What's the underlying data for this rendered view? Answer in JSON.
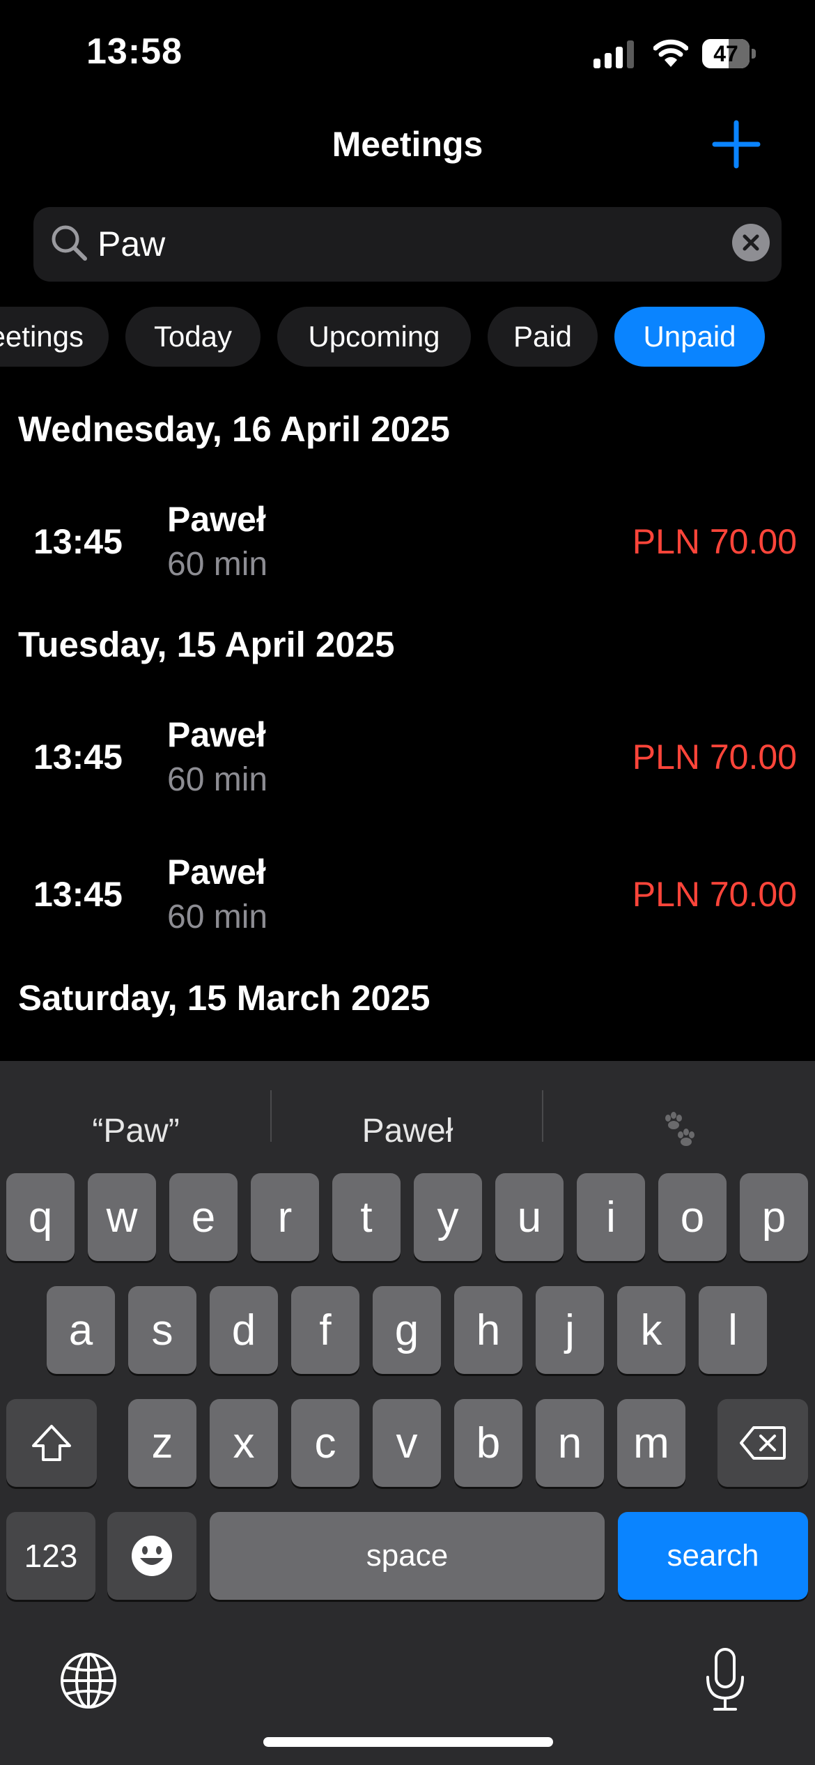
{
  "status_bar": {
    "time": "13:58",
    "battery": "47"
  },
  "nav": {
    "title": "Meetings"
  },
  "search": {
    "value": "Paw"
  },
  "filters": [
    {
      "label": "Meetings",
      "active": false
    },
    {
      "label": "Today",
      "active": false
    },
    {
      "label": "Upcoming",
      "active": false
    },
    {
      "label": "Paid",
      "active": false
    },
    {
      "label": "Unpaid",
      "active": true
    }
  ],
  "sections": [
    {
      "date": "Wednesday, 16 April 2025",
      "meetings": [
        {
          "time": "13:45",
          "name": "Paweł",
          "duration": "60 min",
          "price": "PLN 70.00"
        }
      ]
    },
    {
      "date": "Tuesday, 15 April 2025",
      "meetings": [
        {
          "time": "13:45",
          "name": "Paweł",
          "duration": "60 min",
          "price": "PLN 70.00"
        },
        {
          "time": "13:45",
          "name": "Paweł",
          "duration": "60 min",
          "price": "PLN 70.00"
        }
      ]
    },
    {
      "date": "Saturday, 15 March 2025",
      "meetings": []
    }
  ],
  "keyboard": {
    "suggestions": [
      "“Paw”",
      "Paweł",
      "paw-prints-emoji"
    ],
    "row1": [
      "q",
      "w",
      "e",
      "r",
      "t",
      "y",
      "u",
      "i",
      "o",
      "p"
    ],
    "row2": [
      "a",
      "s",
      "d",
      "f",
      "g",
      "h",
      "j",
      "k",
      "l"
    ],
    "row3": [
      "z",
      "x",
      "c",
      "v",
      "b",
      "n",
      "m"
    ],
    "numbers_label": "123",
    "space_label": "space",
    "return_label": "search"
  },
  "colors": {
    "accent": "#0a84ff",
    "unpaid_price": "#ff453a"
  }
}
